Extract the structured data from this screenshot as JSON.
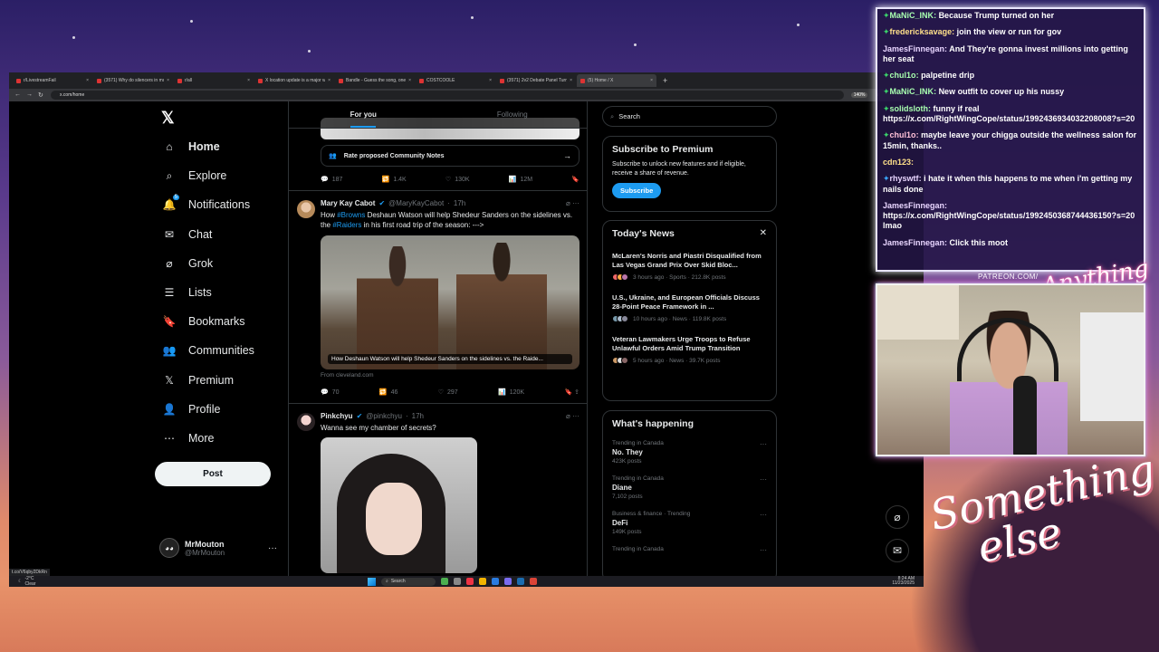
{
  "browser": {
    "tabs": [
      {
        "label": "r/LivestreamFail"
      },
      {
        "label": "(3571) Why do silencers in mo..."
      },
      {
        "label": "r/all"
      },
      {
        "label": "X location update is a major w..."
      },
      {
        "label": "Bandle - Guess the song, one in..."
      },
      {
        "label": "COSTCOOLE"
      },
      {
        "label": "(3571) 2v2 Debate Panel Turns..."
      },
      {
        "label": "(5) Home / X"
      }
    ],
    "url": "x.com/home",
    "zoom": "140%",
    "status_url": "t.co/V6qby2DkRn"
  },
  "x": {
    "nav": [
      {
        "label": "Home",
        "icon": "home-icon"
      },
      {
        "label": "Explore",
        "icon": "search-icon"
      },
      {
        "label": "Notifications",
        "icon": "bell-icon",
        "badge": "5"
      },
      {
        "label": "Chat",
        "icon": "mail-icon"
      },
      {
        "label": "Grok",
        "icon": "grok-icon"
      },
      {
        "label": "Lists",
        "icon": "list-icon"
      },
      {
        "label": "Bookmarks",
        "icon": "bookmark-icon"
      },
      {
        "label": "Communities",
        "icon": "people-icon"
      },
      {
        "label": "Premium",
        "icon": "x-logo-icon"
      },
      {
        "label": "Profile",
        "icon": "person-icon"
      },
      {
        "label": "More",
        "icon": "more-circle-icon"
      }
    ],
    "post_label": "Post",
    "account": {
      "name": "MrMouton",
      "handle": "@MrMouton"
    },
    "feed_tabs": {
      "for_you": "For you",
      "following": "Following"
    },
    "community_notes": "Rate proposed Community Notes",
    "top_actions": {
      "replies": "187",
      "reposts": "1.4K",
      "likes": "130K",
      "views": "12M"
    },
    "tweets": [
      {
        "name": "Mary Kay Cabot",
        "handle": "@MaryKayCabot",
        "time": "17h",
        "text_pre": "How ",
        "tag1": "#Browns",
        "text_mid": " Deshaun Watson will help Shedeur Sanders on the sidelines vs. the ",
        "tag2": "#Raiders",
        "text_post": " in his first road trip of the season: --->",
        "card_title": "How Deshaun Watson will help Shedeur Sanders on the sidelines vs. the Raide...",
        "source": "From cleveland.com",
        "replies": "70",
        "reposts": "46",
        "likes": "297",
        "views": "120K"
      },
      {
        "name": "Pinkchyu",
        "handle": "@pinkchyu",
        "time": "17h",
        "text": "Wanna see my chamber of secrets?"
      }
    ],
    "search_placeholder": "Search",
    "premium": {
      "title": "Subscribe to Premium",
      "body": "Subscribe to unlock new features and if eligible, receive a share of revenue.",
      "button": "Subscribe"
    },
    "news": {
      "title": "Today's News",
      "items": [
        {
          "title": "McLaren's Norris and Piastri Disqualified from Las Vegas Grand Prix Over Skid Bloc...",
          "meta": "3 hours ago · Sports · 212.8K posts"
        },
        {
          "title": "U.S., Ukraine, and European Officials Discuss 28-Point Peace Framework in ...",
          "meta": "10 hours ago · News · 119.8K posts"
        },
        {
          "title": "Veteran Lawmakers Urge Troops to Refuse Unlawful Orders Amid Trump Transition",
          "meta": "5 hours ago · News · 39.7K posts"
        }
      ]
    },
    "happening": {
      "title": "What's happening",
      "items": [
        {
          "label": "Trending in Canada",
          "name": "No. They",
          "posts": "423K posts"
        },
        {
          "label": "Trending in Canada",
          "name": "Diane",
          "posts": "7,102 posts"
        },
        {
          "label": "Business & finance · Trending",
          "name": "DeFi",
          "posts": "149K posts"
        },
        {
          "label": "Trending in Canada",
          "name": "",
          "posts": ""
        }
      ]
    }
  },
  "taskbar": {
    "weather_temp": "-2°C",
    "weather_desc": "Clear",
    "search": "Search",
    "time": "8:24 AM",
    "date": "11/23/2025"
  },
  "chat": [
    {
      "user": "MaNiC_INK",
      "text": "Because Trump turned on her",
      "color": "green",
      "badge": "diamond"
    },
    {
      "user": "fredericksavage",
      "text": "join the view or run for gov",
      "color": "gold",
      "badge": "diamond"
    },
    {
      "user": "JamesFinnegan",
      "text": "And They're gonna invest millions into getting her seat",
      "color": "lav",
      "badge": ""
    },
    {
      "user": "chul1o",
      "text": "palpetine drip",
      "color": "green",
      "badge": "diamond"
    },
    {
      "user": "MaNiC_INK",
      "text": "New outfit to cover up his nussy",
      "color": "green",
      "badge": "diamond"
    },
    {
      "user": "solidsloth",
      "text": "funny if real https://x.com/RightWingCope/status/1992436934032208008?s=20",
      "color": "green",
      "badge": "diamond"
    },
    {
      "user": "chul1o",
      "text": "maybe leave your chigga outside the wellness salon for 15min, thanks..",
      "color": "pink",
      "badge": "diamond"
    },
    {
      "user": "cdn123",
      "text": "",
      "color": "gold",
      "badge": ""
    },
    {
      "user": "rhyswtf",
      "text": "i hate it when this happens to me when i'm getting my nails done",
      "color": "lav",
      "badge": "blue"
    },
    {
      "user": "JamesFinnegan",
      "text": "https://x.com/RightWingCope/status/1992450368744436150?s=20 lmao",
      "color": "lav",
      "badge": ""
    },
    {
      "user": "JamesFinnegan",
      "text": "Click this moot",
      "color": "lav",
      "badge": ""
    }
  ],
  "overlay": {
    "patreon": "PATREON.COM/",
    "brand_top": "Anything else",
    "brand_bottom": "Something else"
  }
}
